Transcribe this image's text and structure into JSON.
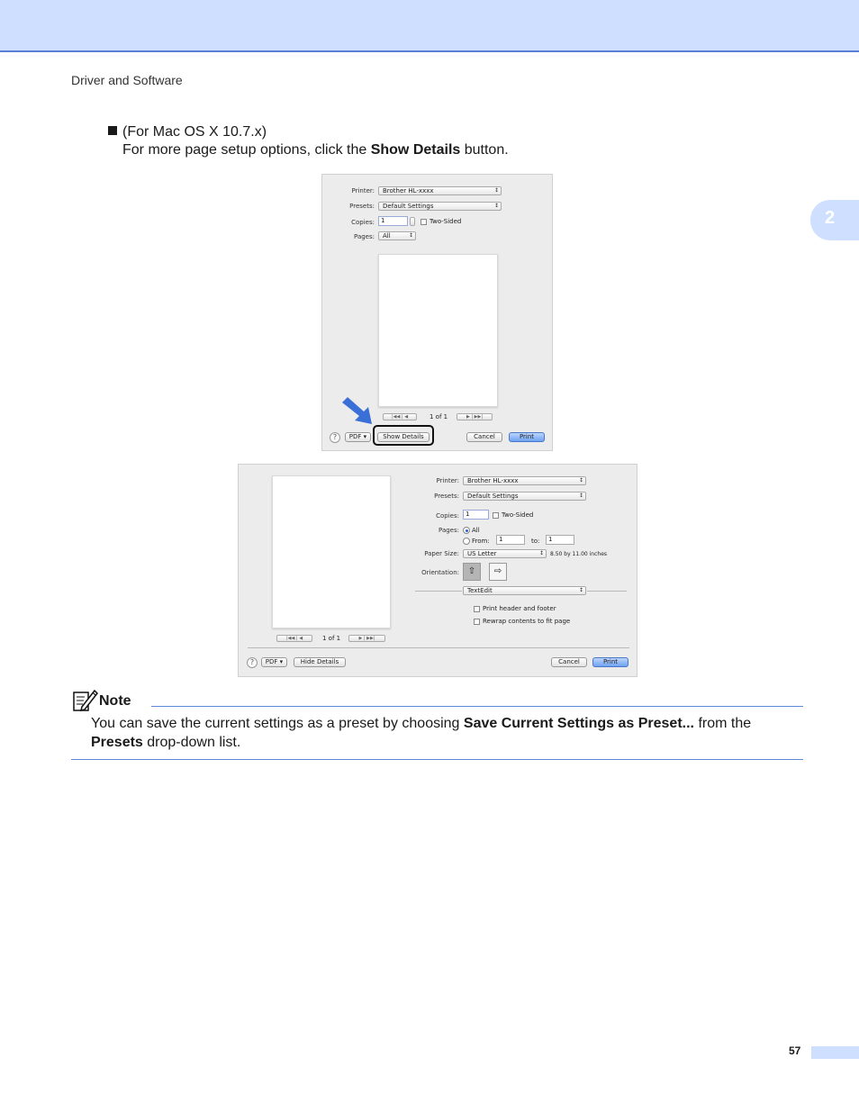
{
  "header": {
    "running_title": "Driver and Software"
  },
  "chapter": {
    "number": "2"
  },
  "body": {
    "bullet_heading": "(For Mac OS X 10.7.x)",
    "instruction_before": "For more page setup options, click the ",
    "instruction_bold": "Show Details",
    "instruction_after": " button."
  },
  "dialog_simple": {
    "printer_label": "Printer:",
    "printer_value": "Brother HL-xxxx",
    "presets_label": "Presets:",
    "presets_value": "Default Settings",
    "copies_label": "Copies:",
    "copies_value": "1",
    "two_sided_label": "Two-Sided",
    "pages_label": "Pages:",
    "pages_value": "All",
    "page_counter": "1 of 1",
    "help_label": "?",
    "pdf_label": "PDF",
    "show_details_label": "Show Details",
    "cancel_label": "Cancel",
    "print_label": "Print"
  },
  "dialog_detailed": {
    "printer_label": "Printer:",
    "printer_value": "Brother HL-xxxx",
    "presets_label": "Presets:",
    "presets_value": "Default Settings",
    "copies_label": "Copies:",
    "copies_value": "1",
    "two_sided_label": "Two-Sided",
    "pages_label": "Pages:",
    "pages_all_label": "All",
    "pages_from_label": "From:",
    "pages_from_value": "1",
    "pages_to_label": "to:",
    "pages_to_value": "1",
    "paper_size_label": "Paper Size:",
    "paper_size_value": "US Letter",
    "paper_size_dimensions": "8.50 by 11.00 inches",
    "orientation_label": "Orientation:",
    "app_section_value": "TextEdit",
    "print_header_footer_label": "Print header and footer",
    "rewrap_label": "Rewrap contents to fit page",
    "page_counter": "1 of 1",
    "help_label": "?",
    "pdf_label": "PDF",
    "hide_details_label": "Hide Details",
    "cancel_label": "Cancel",
    "print_label": "Print"
  },
  "note": {
    "title": "Note",
    "text_1": "You can save the current settings as a preset by choosing ",
    "bold_1": "Save Current Settings as Preset...",
    "text_2": " from the ",
    "bold_2": "Presets",
    "text_3": " drop-down list."
  },
  "footer": {
    "page_number": "57"
  },
  "colors": {
    "accent_band": "#cfdfff",
    "accent_rule": "#5b8ad6",
    "callout_arrow": "#3a6fd8"
  },
  "icons": {
    "bullet": "square-bullet-icon",
    "note": "note-pencil-icon",
    "arrow": "pointer-arrow-icon"
  }
}
